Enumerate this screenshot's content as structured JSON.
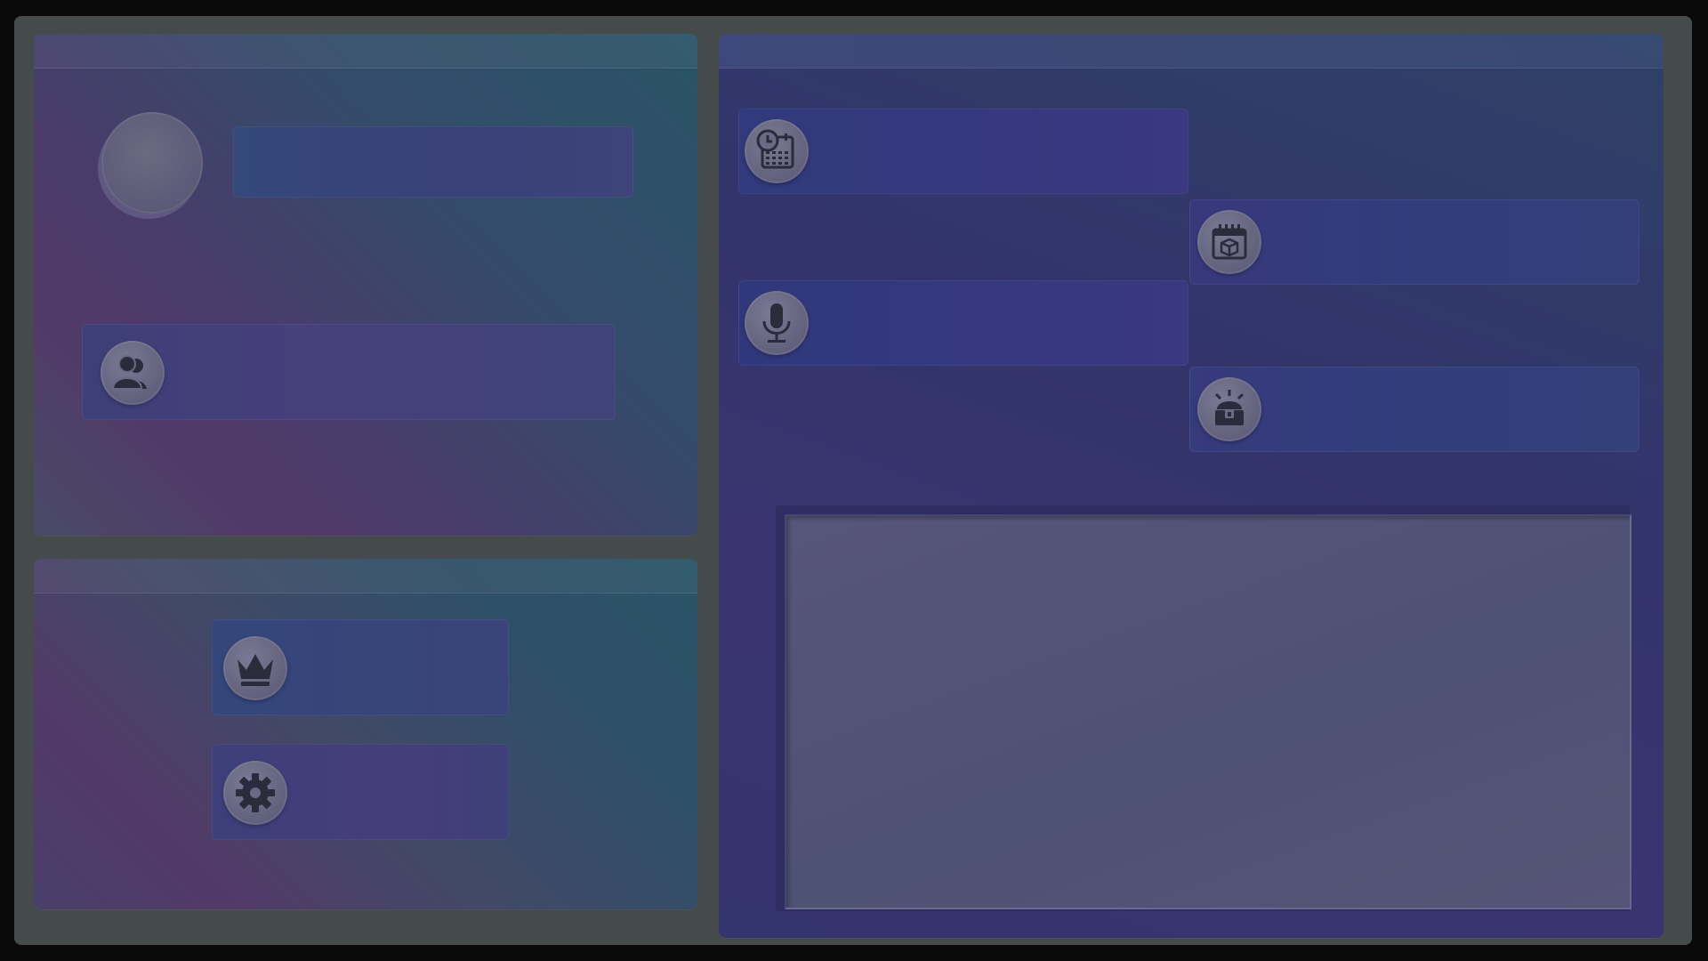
{
  "profile": {
    "name": ""
  },
  "menu": {
    "social_label": "",
    "rankings_label": "",
    "settings_label": ""
  },
  "actions": {
    "schedule_label": "",
    "events_label": "",
    "voice_label": "",
    "inventory_label": ""
  },
  "icons": {
    "social": "users-icon",
    "rankings": "crown-icon",
    "settings": "gear-icon",
    "schedule": "calendar-clock-icon",
    "events": "calendar-gift-icon",
    "voice": "microphone-icon",
    "inventory": "treasure-chest-icon"
  },
  "colors": {
    "frame": "#454a4b",
    "icon_glyph": "#2a2c3c"
  }
}
